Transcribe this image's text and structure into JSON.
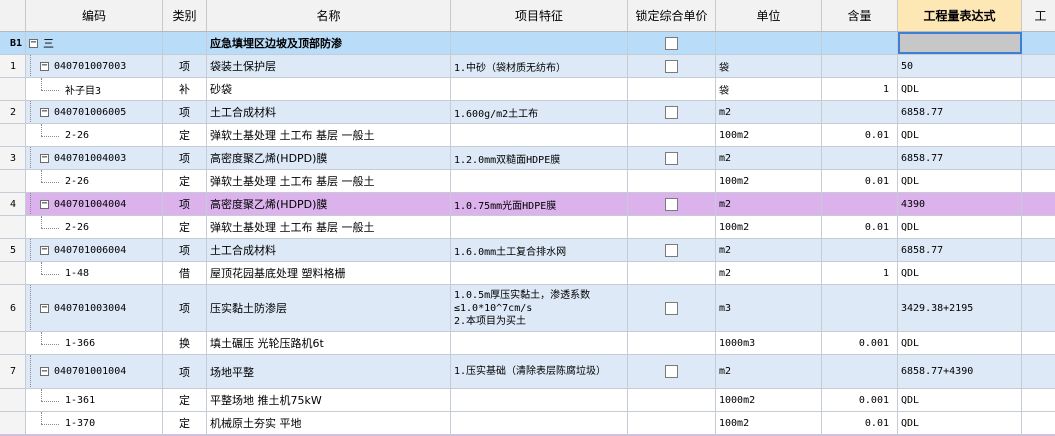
{
  "headers": {
    "rownum": "",
    "code": "编码",
    "type": "类别",
    "name": "名称",
    "feature": "项目特征",
    "lock": "锁定综合单价",
    "unit": "单位",
    "qty": "含量",
    "expr": "工程量表达式",
    "extra": "工"
  },
  "section": {
    "rownum": "B1",
    "toggle": "−",
    "code": "三",
    "name": "应急填埋区边坡及顶部防渗"
  },
  "rows": [
    {
      "kind": "item",
      "rownum": "1",
      "code": "040701007003",
      "type": "项",
      "name": "袋装土保护层",
      "feature": "1.中砂（袋材质无纺布）",
      "unit": "袋",
      "qty": "",
      "expr": "50"
    },
    {
      "kind": "sub",
      "code": "补子目3",
      "type": "补",
      "name": "砂袋",
      "feature": "",
      "unit": "袋",
      "qty": "1",
      "expr": "QDL"
    },
    {
      "kind": "item",
      "rownum": "2",
      "code": "040701006005",
      "type": "项",
      "name": "土工合成材料",
      "feature": "1.600g/m2土工布",
      "unit": "m2",
      "qty": "",
      "expr": "6858.77"
    },
    {
      "kind": "sub",
      "code": "2-26",
      "type": "定",
      "name": "弹软土基处理 土工布 基层 一般土",
      "feature": "",
      "unit": "100m2",
      "qty": "0.01",
      "expr": "QDL"
    },
    {
      "kind": "item",
      "rownum": "3",
      "code": "040701004003",
      "type": "项",
      "name": "高密度聚乙烯(HDPD)膜",
      "feature": "1.2.0mm双糙面HDPE膜",
      "unit": "m2",
      "qty": "",
      "expr": "6858.77"
    },
    {
      "kind": "sub",
      "code": "2-26",
      "type": "定",
      "name": "弹软土基处理 土工布 基层 一般土",
      "feature": "",
      "unit": "100m2",
      "qty": "0.01",
      "expr": "QDL"
    },
    {
      "kind": "sel",
      "rownum": "4",
      "code": "040701004004",
      "type": "项",
      "name": "高密度聚乙烯(HDPD)膜",
      "feature": "1.0.75mm光面HDPE膜",
      "unit": "m2",
      "qty": "",
      "expr": "4390"
    },
    {
      "kind": "sub",
      "code": "2-26",
      "type": "定",
      "name": "弹软土基处理 土工布 基层 一般土",
      "feature": "",
      "unit": "100m2",
      "qty": "0.01",
      "expr": "QDL"
    },
    {
      "kind": "item",
      "rownum": "5",
      "code": "040701006004",
      "type": "项",
      "name": "土工合成材料",
      "feature": "1.6.0mm土工复合排水网",
      "unit": "m2",
      "qty": "",
      "expr": "6858.77"
    },
    {
      "kind": "sub",
      "code": "1-48",
      "type": "借",
      "name": "屋顶花园基底处理 塑料格栅",
      "feature": "",
      "unit": "m2",
      "qty": "1",
      "expr": "QDL"
    },
    {
      "kind": "item",
      "tall": true,
      "rownum": "6",
      "code": "040701003004",
      "type": "项",
      "name": "压实黏土防渗层",
      "feature": "1.0.5m厚压实黏土，渗透系数≤1.0*10^7cm/s\n2.本项目为买土",
      "unit": "m3",
      "qty": "",
      "expr": "3429.38+2195"
    },
    {
      "kind": "sub",
      "code": "1-366",
      "type": "换",
      "name": "填土碾压 光轮压路机6t",
      "feature": "",
      "unit": "1000m3",
      "qty": "0.001",
      "expr": "QDL"
    },
    {
      "kind": "item",
      "mid": true,
      "rownum": "7",
      "code": "040701001004",
      "type": "项",
      "name": "场地平整",
      "feature": "1.压实基础（清除表层陈腐垃圾）",
      "unit": "m2",
      "qty": "",
      "expr": "6858.77+4390"
    },
    {
      "kind": "sub",
      "code": "1-361",
      "type": "定",
      "name": "平整场地 推土机75kW",
      "feature": "",
      "unit": "1000m2",
      "qty": "0.001",
      "expr": "QDL"
    },
    {
      "kind": "sub",
      "code": "1-370",
      "type": "定",
      "name": "机械原土夯实 平地",
      "feature": "",
      "unit": "100m2",
      "qty": "0.01",
      "expr": "QDL"
    }
  ],
  "colors": {
    "section": "#b9dcf9",
    "item": "#dde9f7",
    "selected": "#dbb2ec",
    "header_highlight": "#fde7b4"
  }
}
